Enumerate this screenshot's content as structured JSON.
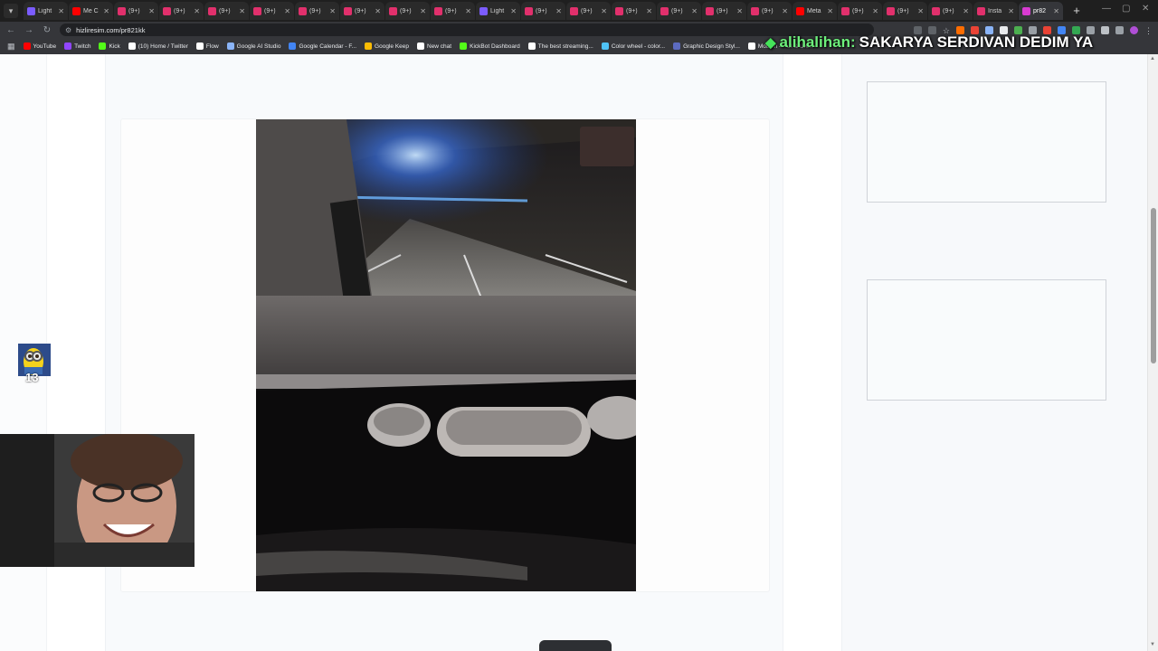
{
  "browser": {
    "tabs": [
      {
        "label": "Light",
        "color": "#7b5cff"
      },
      {
        "label": "Me C",
        "color": "#ff0000"
      },
      {
        "label": "(9+)",
        "color": "#e1306c"
      },
      {
        "label": "(9+)",
        "color": "#e1306c"
      },
      {
        "label": "(9+)",
        "color": "#e1306c"
      },
      {
        "label": "(9+)",
        "color": "#e1306c"
      },
      {
        "label": "(9+)",
        "color": "#e1306c"
      },
      {
        "label": "(9+)",
        "color": "#e1306c"
      },
      {
        "label": "(9+)",
        "color": "#e1306c"
      },
      {
        "label": "(9+)",
        "color": "#e1306c"
      },
      {
        "label": "Light",
        "color": "#7b5cff"
      },
      {
        "label": "(9+)",
        "color": "#e1306c"
      },
      {
        "label": "(9+)",
        "color": "#e1306c"
      },
      {
        "label": "(9+)",
        "color": "#e1306c"
      },
      {
        "label": "(9+)",
        "color": "#e1306c"
      },
      {
        "label": "(9+)",
        "color": "#e1306c"
      },
      {
        "label": "(9+)",
        "color": "#e1306c"
      },
      {
        "label": "Meta",
        "color": "#ff0000"
      },
      {
        "label": "(9+)",
        "color": "#e1306c"
      },
      {
        "label": "(9+)",
        "color": "#e1306c"
      },
      {
        "label": "(9+)",
        "color": "#e1306c"
      },
      {
        "label": "Insta",
        "color": "#e1306c"
      },
      {
        "label": "pr82",
        "color": "#d83bd2",
        "active": true
      }
    ],
    "url": "hizliresim.com/pr821kk",
    "bookmarks": [
      {
        "label": "YouTube",
        "color": "#ff0000"
      },
      {
        "label": "Twitch",
        "color": "#9146ff"
      },
      {
        "label": "Kick",
        "color": "#53fc18"
      },
      {
        "label": "(10) Home / Twitter",
        "color": "#ffffff"
      },
      {
        "label": "Flow",
        "color": "#ffffff"
      },
      {
        "label": "Google AI Studio",
        "color": "#8ab4f8"
      },
      {
        "label": "Google Calendar - F...",
        "color": "#4285f4"
      },
      {
        "label": "Google Keep",
        "color": "#fbbc04"
      },
      {
        "label": "New chat",
        "color": "#ffffff"
      },
      {
        "label": "KickBot Dashboard",
        "color": "#53fc18"
      },
      {
        "label": "The best streaming...",
        "color": "#ffffff"
      },
      {
        "label": "Color wheel - color...",
        "color": "#4fc3f7"
      },
      {
        "label": "Graphic Design Styl...",
        "color": "#5c6bc0"
      },
      {
        "label": "Mobbin — UI & UX...",
        "color": "#ffffff"
      }
    ]
  },
  "chat": {
    "username": "alihalihan:",
    "message": "SAKARYA SERDIVAN DEDIM YA"
  },
  "overlay": {
    "minion_label": "13"
  },
  "colors": {
    "accent_green": "#45e35a",
    "page_bg": "#f8fafc"
  }
}
